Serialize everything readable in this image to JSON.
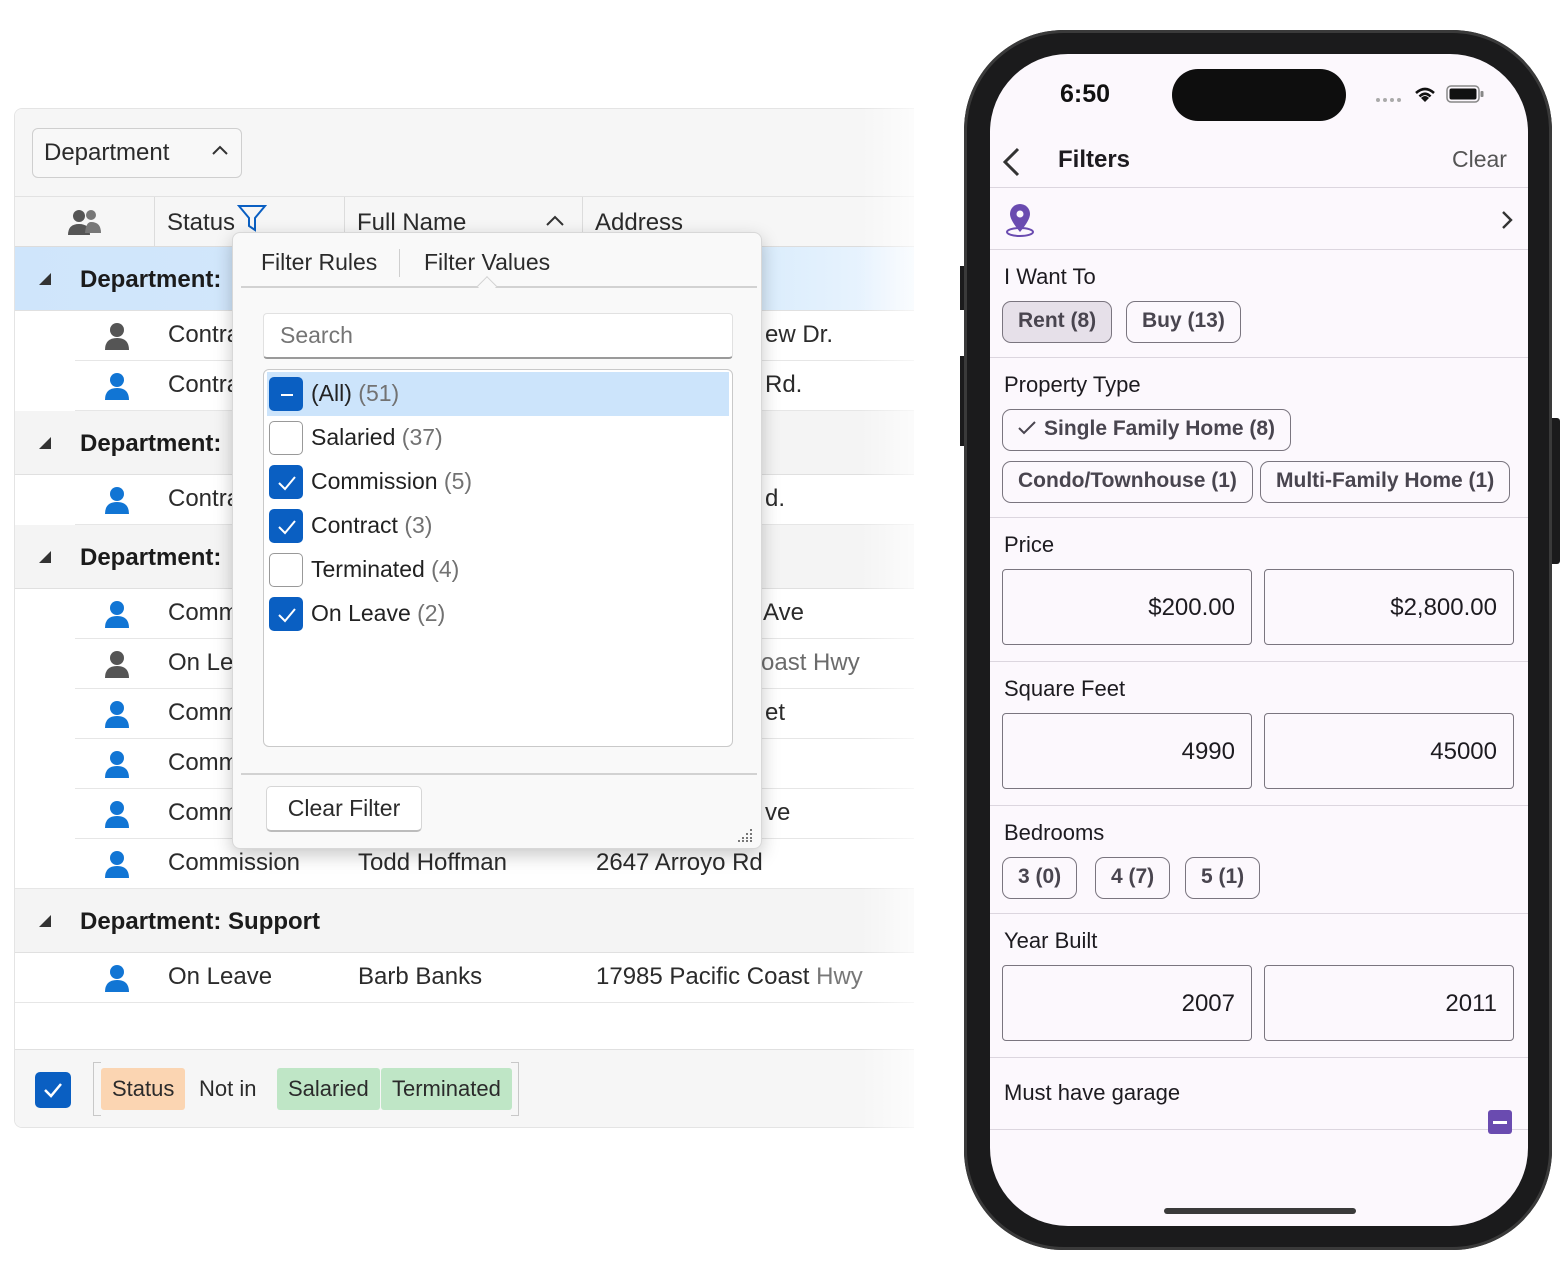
{
  "grid": {
    "group_chip": "Department",
    "headers": {
      "status": "Status",
      "full_name": "Full Name",
      "address": "Address"
    },
    "groups": [
      {
        "label": "Department:",
        "rows": [
          {
            "status": "Contra",
            "address": "ew Dr."
          },
          {
            "status": "Contra",
            "address": "Rd."
          }
        ]
      },
      {
        "label": "Department:",
        "rows": [
          {
            "status": "Contra",
            "address": "d."
          }
        ]
      },
      {
        "label": "Department:",
        "rows": [
          {
            "status": "Comm",
            "address": "Ave"
          },
          {
            "status": "On Le",
            "address": "oast Hwy"
          },
          {
            "status": "Comm",
            "address": "et"
          },
          {
            "status": "Comm",
            "address": ""
          },
          {
            "status": "Comm",
            "address": "ve"
          },
          {
            "status": "Commission",
            "name": "Todd Hoffman",
            "address": "2647 Arroyo Rd"
          }
        ]
      },
      {
        "label": "Department: Support",
        "rows": [
          {
            "status": "On Leave",
            "name": "Barb Banks",
            "address_a": "17985 Pacific Coast",
            "address_b": " Hwy"
          }
        ]
      }
    ]
  },
  "filter_popup": {
    "tab_rules": "Filter Rules",
    "tab_values": "Filter Values",
    "search_placeholder": "Search",
    "items": [
      {
        "label": "(All)",
        "count": "(51)",
        "state": "partial"
      },
      {
        "label": "Salaried",
        "count": "(37)",
        "state": "off"
      },
      {
        "label": "Commission",
        "count": "(5)",
        "state": "on"
      },
      {
        "label": "Contract",
        "count": "(3)",
        "state": "on"
      },
      {
        "label": "Terminated",
        "count": "(4)",
        "state": "off"
      },
      {
        "label": "On Leave",
        "count": "(2)",
        "state": "on"
      }
    ],
    "clear_filter": "Clear Filter"
  },
  "filter_bar": {
    "enabled": true,
    "field": "Status",
    "operator": "Not in",
    "values": [
      "Salaried",
      "Terminated"
    ]
  },
  "phone": {
    "time": "6:50",
    "title": "Filters",
    "clear": "Clear",
    "location_icon": "location-pin-icon",
    "i_want_to": {
      "title": "I Want To",
      "rent": "Rent (8)",
      "buy": "Buy (13)"
    },
    "property_type": {
      "title": "Property Type",
      "single": "Single Family Home (8)",
      "condo": "Condo/Townhouse (1)",
      "multi": "Multi-Family Home (1)"
    },
    "price": {
      "title": "Price",
      "min": "$200.00",
      "max": "$2,800.00"
    },
    "square_feet": {
      "title": "Square Feet",
      "min": "4990",
      "max": "45000"
    },
    "bedrooms": {
      "title": "Bedrooms",
      "b3": "3 (0)",
      "b4": "4 (7)",
      "b5": "5 (1)"
    },
    "year_built": {
      "title": "Year Built",
      "min": "2007",
      "max": "2011"
    },
    "garage": {
      "label": "Must have garage",
      "state": "indeterminate"
    },
    "accent": "#6a4bb0"
  },
  "colors": {
    "accent_blue": "#0a5fc2",
    "selection_blue": "#cce4fb",
    "tag_orange": "#fbd5b2",
    "tag_green": "#bfe6c6"
  }
}
